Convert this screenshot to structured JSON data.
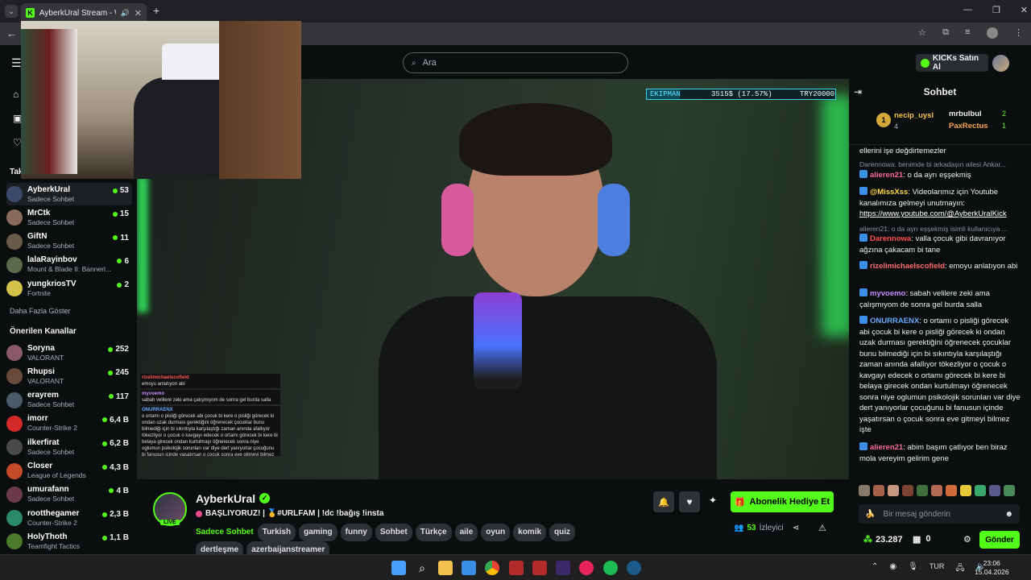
{
  "browser": {
    "tab_title": "AyberkUral Stream - Watch",
    "new_tab_icon": "plus-icon"
  },
  "header": {
    "search_placeholder": "Ara",
    "kicks_label": "KICKs Satın Al"
  },
  "sidebar": {
    "followed_heading": "Tak",
    "followed": [
      {
        "name": "AyberkUral",
        "sub": "Sadece Sohbet",
        "viewers": "53"
      },
      {
        "name": "MrCtk",
        "sub": "Sadece Sohbet",
        "viewers": "15"
      },
      {
        "name": "GiftN",
        "sub": "Sadece Sohbet",
        "viewers": "11"
      },
      {
        "name": "lalaRayinbov",
        "sub": "Mount & Blade II: Bannerl...",
        "viewers": "6"
      },
      {
        "name": "yungkriosTV",
        "sub": "Fortnite",
        "viewers": "2"
      }
    ],
    "show_more": "Daha Fazla Göster",
    "recommended_heading": "Önerilen Kanallar",
    "recommended": [
      {
        "name": "Soryna",
        "sub": "VALORANT",
        "viewers": "252"
      },
      {
        "name": "Rhupsi",
        "sub": "VALORANT",
        "viewers": "245"
      },
      {
        "name": "erayrem",
        "sub": "Sadece Sohbet",
        "viewers": "117"
      },
      {
        "name": "imorr",
        "sub": "Counter-Strike 2",
        "viewers": "6,4 B"
      },
      {
        "name": "ilkerfirat",
        "sub": "Sadece Sohbet",
        "viewers": "6,2 B"
      },
      {
        "name": "Closer",
        "sub": "League of Legends",
        "viewers": "4,3 B"
      },
      {
        "name": "umurafann",
        "sub": "Sadece Sohbet",
        "viewers": "4 B"
      },
      {
        "name": "rootthegamer",
        "sub": "Counter-Strike 2",
        "viewers": "2,3 B"
      },
      {
        "name": "HolyThoth",
        "sub": "Teamfight Tactics",
        "viewers": "1,1 B"
      }
    ]
  },
  "video": {
    "overlay_name": "EKIPMAN",
    "overlay_progress": "3515$ (17.57%)",
    "overlay_progress_fraction": 0.1757,
    "overlay_goal": "TRY20000",
    "overlay_chat": [
      {
        "user": "rizelimichaelscofield",
        "text": "emoyu anlatıyon abi"
      },
      {
        "user": "myvoemo",
        "text": "sabah velilere zeki ama çalışmıyom de sonra gel burda salla"
      },
      {
        "user": "ONURRAENX",
        "text": "o ortamı o pisliği görecek abi çocuk bi kere o pisliği görecek ki ondan uzak durması gerektiğini öğrenecek çocuklar bunu bilmediği için bi sıkıntıyla karşılaştığı zaman anında afallıyor tökezliyor o çocuk o kavgayı edecek o ortamı görecek bi kere bi belaya girecek ondan kurtulmayı öğrenecek sonra niye oglumun psikolojik sorunları var diye dert yanıyorlar çocuğunu bi fanusun içinde yaşatırsan o çocuk sonra eve gitmeyi bilmez işte"
      }
    ]
  },
  "stream_info": {
    "streamer": "AyberkUral",
    "live_badge": "LIVE",
    "title": "BAŞLIYORUZ! | 🥇#URLFAM | !dc !bağış !insta",
    "category": "Sadece Sohbet",
    "tags": [
      "Turkish",
      "gaming",
      "funny",
      "Sohbet",
      "Türkçe",
      "aile",
      "oyun",
      "komik",
      "quiz",
      "dertleşme",
      "azerbaijanstreamer"
    ],
    "gift_button": "Abonelik Hediye Et",
    "viewer_count": "53",
    "viewer_label": "İzleyici"
  },
  "chat": {
    "title": "Sohbet",
    "leaderboard": [
      {
        "name": "necip_uysl",
        "score": "4",
        "rank": "1"
      },
      {
        "name": "mrbulbul",
        "score": "2"
      },
      {
        "name": "PaxRectus",
        "score": "1"
      }
    ],
    "messages": [
      {
        "user": "",
        "text": "ellerini işe değdirtemezler"
      },
      {
        "reply": "Darennowa: benimde bi arkadaşın ailesi Ankar..."
      },
      {
        "user": "alieren21",
        "text": "o da ayrı eşşekmiş",
        "color": "#ff6b9a"
      },
      {
        "user": "@MissXss",
        "text": "Videolarımız için Youtube kanalımıza gelmeyi unutmayın:",
        "link": "https://www.youtube.com/@AyberkUralKick",
        "color": "#ffd84a"
      },
      {
        "reply": "alieren21: o da ayrı eşşekmiş isimli kullanıcıya ..."
      },
      {
        "user": "Darennowa",
        "text": "valla çocuk gibi davranıyor ağzına çakacam bi tane",
        "color": "#ff4f4f"
      },
      {
        "user": "rizelimichaelscofield",
        "text": "emoyu anlatıyon abi",
        "color": "#ff6b6b"
      },
      {
        "user": "myvoemo",
        "text": "sabah velilere zeki ama çalışmıyom de sonra gel burda salla",
        "color": "#c88bff"
      },
      {
        "user": "ONURRAENX",
        "text": "o ortamı o pisliği görecek abi çocuk bi kere o pisliği görecek ki ondan uzak durması gerektiğini öğrenecek çocuklar bunu bilmediği için bi sıkıntıyla karşılaştığı zaman anında afallıyor tökezliyor o çocuk o kavgayı edecek o ortamı görecek bi kere bi belaya girecek ondan kurtulmayı öğrenecek sonra niye oglumun psikolojik sorunları var diye dert yanıyorlar çocuğunu bi fanusun içinde yaşatırsan o çocuk sonra eve gitmeyi bilmez işte",
        "color": "#6aa8ff"
      },
      {
        "user": "alieren21",
        "text": "abim başım çatlıyor ben biraz mola vereyim gelirim gene",
        "color": "#ff6b9a"
      }
    ],
    "input_placeholder": "Bir mesaj gönderin",
    "points": "23.287",
    "gift_count": "0",
    "send_button": "Gönder"
  },
  "taskbar": {
    "lang": "TUR",
    "time": "23:06",
    "date": "15.04.2026"
  },
  "colors": {
    "accent": "#53fc18",
    "background": "#0b0e0f"
  }
}
